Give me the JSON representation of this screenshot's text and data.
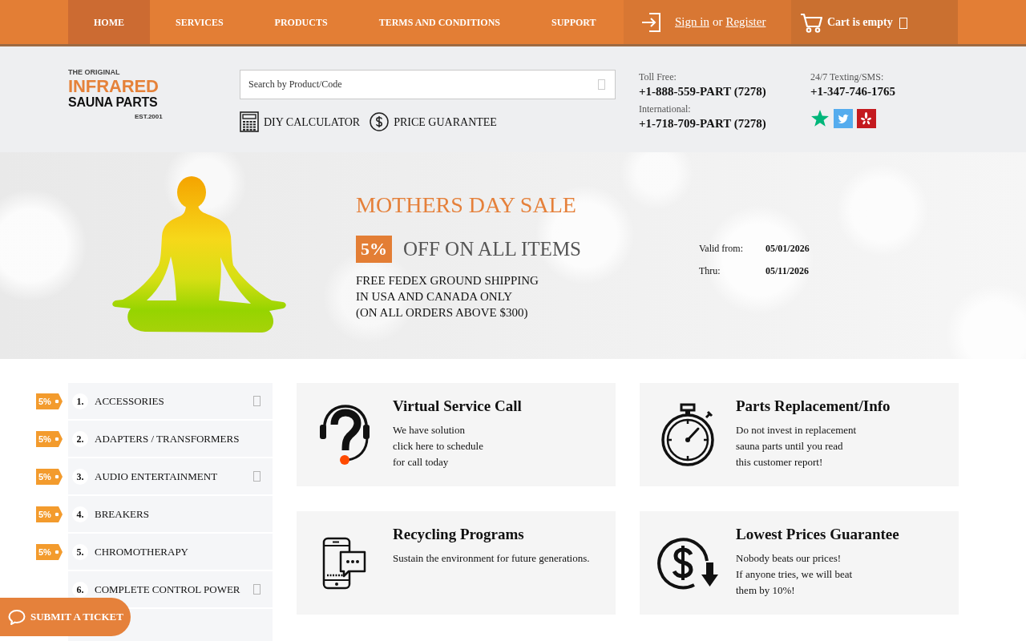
{
  "nav": {
    "items": [
      {
        "label": "HOME",
        "selected": true
      },
      {
        "label": "SERVICES",
        "selected": false
      },
      {
        "label": "PRODUCTS",
        "selected": false
      },
      {
        "label": "TERMS AND CONDITIONS",
        "selected": false
      },
      {
        "label": "SUPPORT",
        "selected": false
      }
    ],
    "account": {
      "sign_in": "Sign in",
      "separator": "or",
      "register": "Register"
    },
    "cart": {
      "label": "Cart is empty"
    }
  },
  "header": {
    "logo": {
      "tagline": "THE ORIGINAL",
      "name": "INFRARED",
      "subname": "SAUNA PARTS",
      "established": "EST.2001"
    },
    "search": {
      "placeholder": "Search by Product/Code"
    },
    "links": [
      {
        "label": "DIY CALCULATOR"
      },
      {
        "label": "PRICE GUARANTEE"
      }
    ],
    "contacts": [
      {
        "label": "Toll Free:",
        "phone": "+1-888-559-PART (7278)"
      },
      {
        "label": "International:",
        "phone": "+1-718-709-PART (7278)"
      }
    ],
    "sms": {
      "label": "24/7 Texting/SMS:",
      "phone": "+1-347-746-1765"
    }
  },
  "banner": {
    "title": "MOTHERS DAY SALE",
    "discount": "5%",
    "headline": "OFF ON ALL ITEMS",
    "shipping": "FREE FEDEX GROUND SHIPPING\nIN USA AND CANADA ONLY\n(ON ALL ORDERS ABOVE $300)",
    "validity": [
      {
        "label": "Valid from:",
        "date": "05/01/2026"
      },
      {
        "label": "Thru:",
        "date": "05/11/2026"
      }
    ]
  },
  "sidebar": {
    "items": [
      {
        "number": "1.",
        "label": "ACCESSORIES",
        "tag": "5%",
        "expandable": true
      },
      {
        "number": "2.",
        "label": "ADAPTERS / TRANSFORMERS",
        "tag": "5%",
        "expandable": false
      },
      {
        "number": "3.",
        "label": "AUDIO ENTERTAINMENT",
        "tag": "5%",
        "expandable": true
      },
      {
        "number": "4.",
        "label": "BREAKERS",
        "tag": "5%",
        "expandable": false
      },
      {
        "number": "5.",
        "label": "CHROMOTHERAPY",
        "tag": "5%",
        "expandable": false
      },
      {
        "number": "6.",
        "label": "COMPLETE CONTROL POWER",
        "expandable": true
      }
    ]
  },
  "cards": [
    {
      "title": "Virtual Service Call",
      "text": "We have solution\nclick here to schedule\nfor call today"
    },
    {
      "title": "Parts Replacement/Info",
      "text": "Do not invest in replacement\nsauna parts until you read\nthis customer report!"
    },
    {
      "title": "Recycling Programs",
      "text": "Sustain the environment for future generations."
    },
    {
      "title": "Lowest Prices Guarantee",
      "text": "Nobody beats our prices!\nIf anyone tries, we will beat\nthem by 10%!"
    }
  ],
  "ticket_button": {
    "label": "SUBMIT A TICKET"
  }
}
